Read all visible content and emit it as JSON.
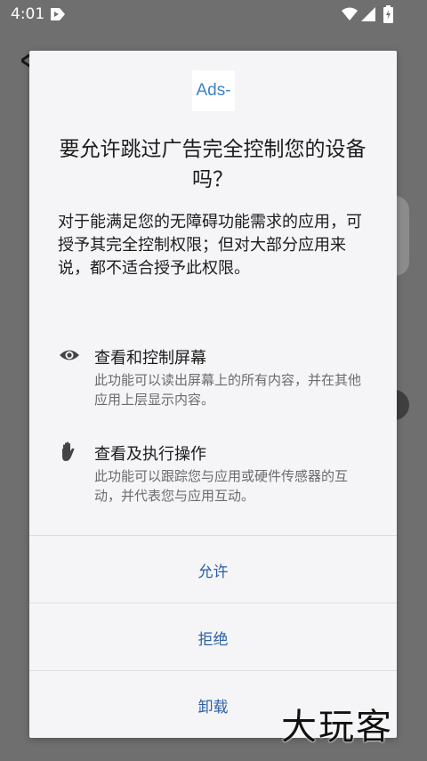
{
  "status_bar": {
    "time": "4:01",
    "icons": [
      "notification-icon",
      "wifi-icon",
      "signal-icon",
      "battery-charging-icon"
    ]
  },
  "dialog": {
    "app_logo_text": "Ads-",
    "title": "要允许跳过广告完全控制您的设备吗？",
    "description": "对于能满足您的无障碍功能需求的应用，可授予其完全控制权限；但对大部分应用来说，都不适合授予此权限。",
    "permissions": [
      {
        "icon": "eye-icon",
        "title": "查看和控制屏幕",
        "description": "此功能可以读出屏幕上的所有内容，并在其他应用上层显示内容。"
      },
      {
        "icon": "hand-icon",
        "title": "查看及执行操作",
        "description": "此功能可以跟踪您与应用或硬件传感器的互动，并代表您与应用互动。"
      }
    ],
    "buttons": {
      "allow": "允许",
      "deny": "拒绝",
      "uninstall": "卸载"
    }
  },
  "watermark": "大玩客",
  "colors": {
    "scrim": "#6f6f6f",
    "dialog_bg": "#f5f5f7",
    "button_text": "#2b5fa6",
    "logo_text": "#3d83c5"
  }
}
